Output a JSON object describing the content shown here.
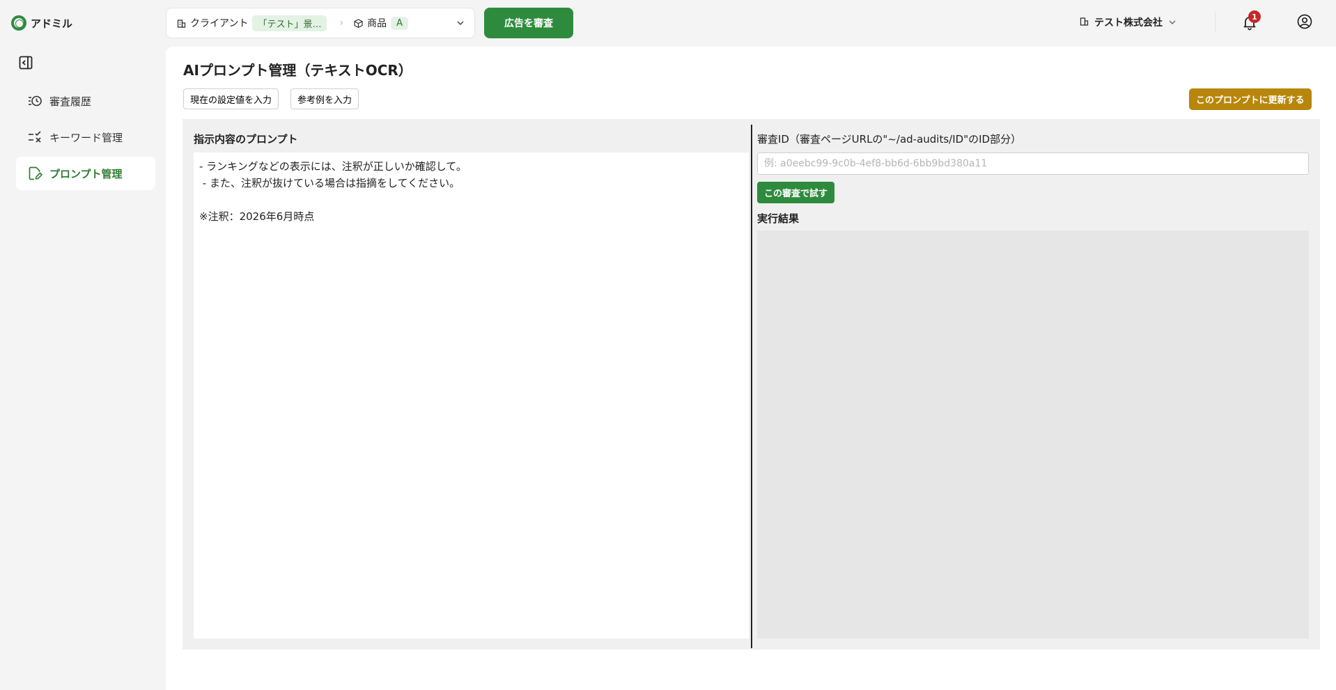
{
  "app": {
    "name": "アドミル"
  },
  "context": {
    "client_label": "クライアント",
    "client_value": "「テスト」景…",
    "product_label": "商品",
    "product_value": "A"
  },
  "header": {
    "audit_button": "広告を審査",
    "company": "テスト株式会社",
    "notification_count": "1"
  },
  "sidebar": {
    "items": [
      {
        "label": "審査履歴",
        "icon": "history-icon",
        "active": false
      },
      {
        "label": "キーワード管理",
        "icon": "keyword-check-icon",
        "active": false
      },
      {
        "label": "プロンプト管理",
        "icon": "edit-document-icon",
        "active": true
      }
    ]
  },
  "page": {
    "title": "AIプロンプト管理（テキストOCR）",
    "fill_current_button": "現在の設定値を入力",
    "fill_example_button": "参考例を入力",
    "update_button": "このプロンプトに更新する"
  },
  "prompt": {
    "heading": "指示内容のプロンプト",
    "text": "- ランキングなどの表示には、注釈が正しいか確認して。\n - また、注釈が抜けている場合は指摘をしてください。\n\n※注釈：2026年6月時点"
  },
  "test": {
    "id_label": "審査ID（審査ページURLの\"~/ad-audits/ID\"のID部分）",
    "id_placeholder": "例: a0eebc99-9c0b-4ef8-bb6d-6bb9bd380a11",
    "id_value": "",
    "try_button": "この審査で試す",
    "result_heading": "実行結果",
    "result_text": ""
  },
  "colors": {
    "primary_green": "#2e8b3e",
    "update_gold": "#b8860b",
    "badge_red": "#c62828",
    "active_nav_text": "#2e7d32"
  }
}
